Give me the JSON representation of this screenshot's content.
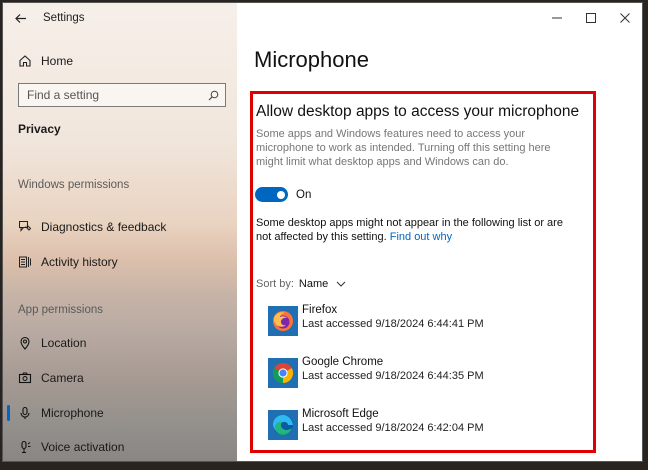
{
  "window": {
    "title": "Settings"
  },
  "sidebar": {
    "home": "Home",
    "search_placeholder": "Find a setting",
    "category": "Privacy",
    "section1": "Windows permissions",
    "items1": [
      {
        "label": "Diagnostics & feedback",
        "icon": "feedback-icon"
      },
      {
        "label": "Activity history",
        "icon": "activity-history-icon"
      }
    ],
    "section2": "App permissions",
    "items2": [
      {
        "label": "Location",
        "icon": "location-icon"
      },
      {
        "label": "Camera",
        "icon": "camera-icon"
      },
      {
        "label": "Microphone",
        "icon": "microphone-icon"
      },
      {
        "label": "Voice activation",
        "icon": "voice-activation-icon"
      }
    ]
  },
  "main": {
    "title": "Microphone",
    "section_title": "Allow desktop apps to access your microphone",
    "description": "Some apps and Windows features need to access your microphone to work as intended. Turning off this setting here might limit what desktop apps and Windows can do.",
    "toggle_label": "On",
    "toggle_on": true,
    "note": "Some desktop apps might not appear in the following list or are not affected by this setting.",
    "note_link": "Find out why",
    "sort_label": "Sort by:",
    "sort_value": "Name",
    "apps": [
      {
        "name": "Firefox",
        "accessed": "Last accessed 9/18/2024 6:44:41 PM"
      },
      {
        "name": "Google Chrome",
        "accessed": "Last accessed 9/18/2024 6:44:35 PM"
      },
      {
        "name": "Microsoft Edge",
        "accessed": "Last accessed 9/18/2024 6:42:04 PM"
      }
    ]
  },
  "colors": {
    "accent": "#0067c0",
    "highlight": "#e10000"
  }
}
